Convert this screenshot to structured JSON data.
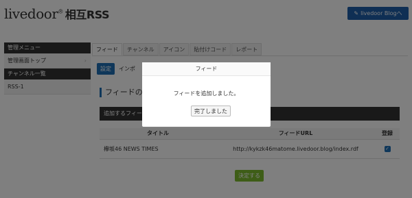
{
  "header": {
    "logo_main": "livedoor",
    "logo_mark": "®",
    "logo_sub": "相互RSS",
    "blog_button": "livedoor Blogへ",
    "blog_icon": "pencil-icon"
  },
  "sidebar": {
    "admin_heading": "管理メニュー",
    "admin_top": "管理画面トップ",
    "channel_heading": "チャンネル一覧",
    "channel_item": "RSS-1"
  },
  "tabs": [
    "フィード",
    "チャンネル",
    "アイコン",
    "貼付けコード",
    "レポート"
  ],
  "subtabs": {
    "active": "設定",
    "other": "インポ"
  },
  "section": {
    "title": "フィードの追",
    "bar": "追加するフィー"
  },
  "table": {
    "headers": {
      "title": "タイトル",
      "url": "フィードURL",
      "register": "登録"
    },
    "rows": [
      {
        "title": "欅坂46 NEWS TIMES",
        "url": "http://kykzk46matome.livedoor.blog/index.rdf",
        "checked": true
      }
    ]
  },
  "decide_button": "決定する",
  "modal": {
    "title": "フィード",
    "message": "フィードを追加しました。",
    "ok_button": "完了しました"
  },
  "colors": {
    "accent": "#1e6fb5",
    "dark": "#333333",
    "green": "#7dbb2f"
  }
}
